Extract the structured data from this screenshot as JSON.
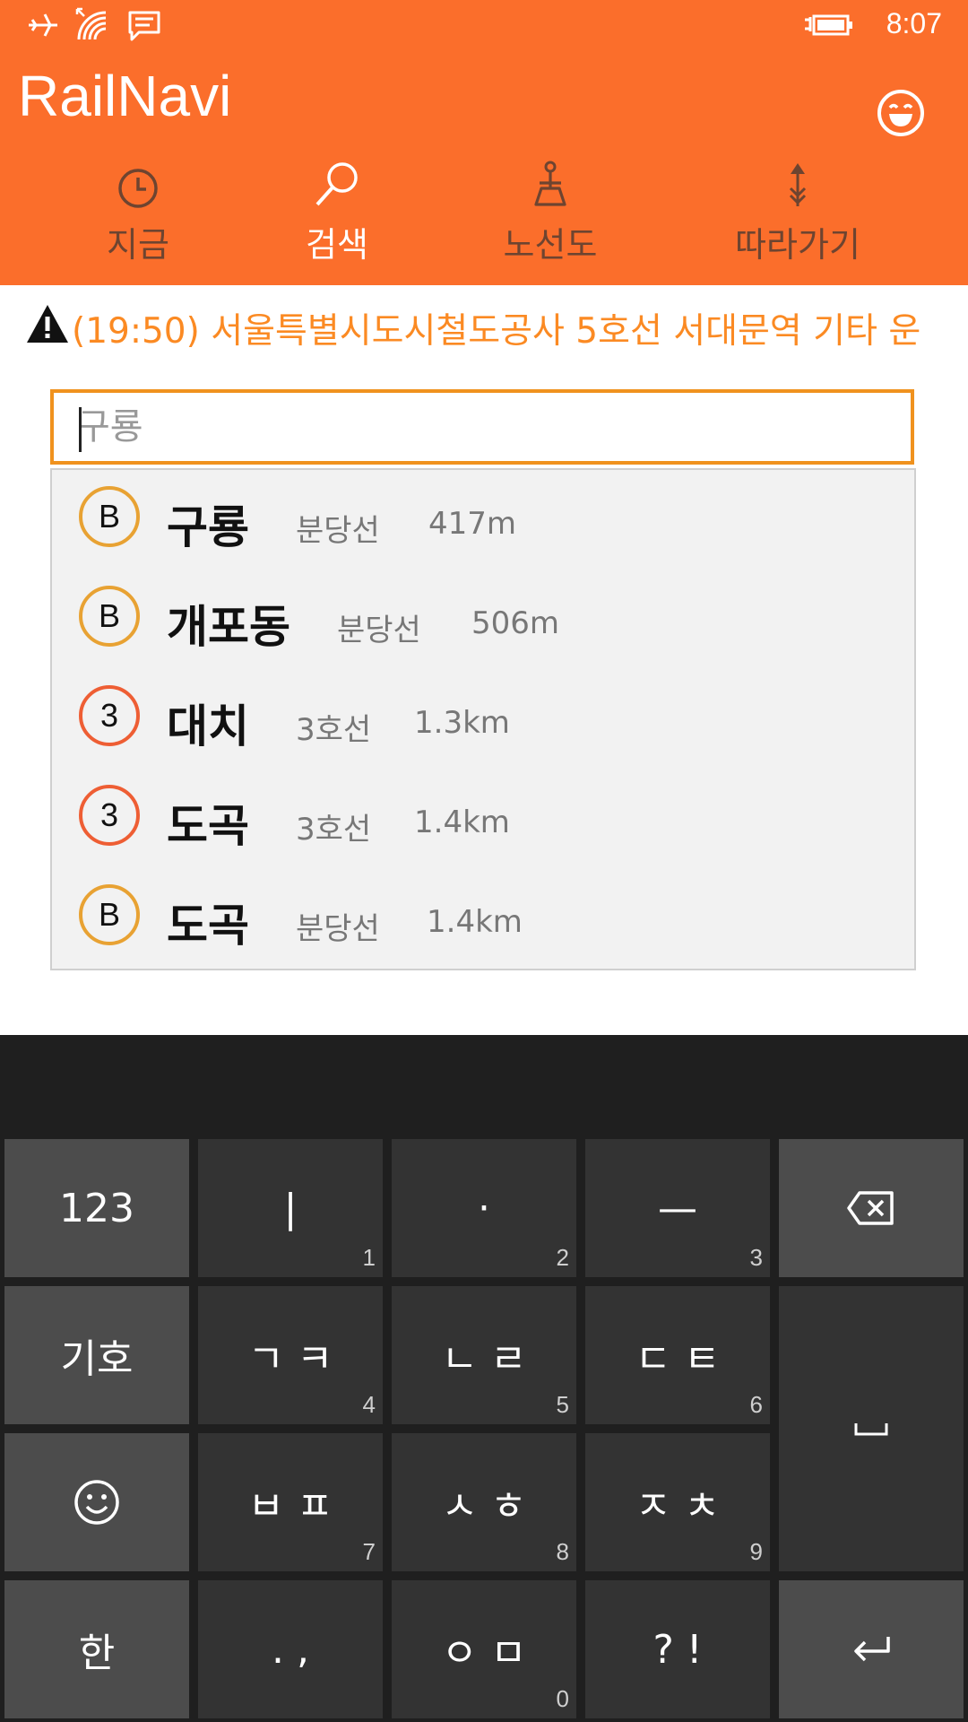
{
  "status_bar": {
    "time": "8:07",
    "icons": [
      "airplane-mode-icon",
      "wifi-icon",
      "message-icon",
      "battery-charging-icon"
    ]
  },
  "app": {
    "title": "RailNavi",
    "accent_color": "#fb6e2b"
  },
  "tabs": [
    {
      "label": "지금",
      "icon": "clock-icon"
    },
    {
      "label": "검색",
      "icon": "search-icon"
    },
    {
      "label": "노선도",
      "icon": "map-icon"
    },
    {
      "label": "따라가기",
      "icon": "follow-arrow-icon"
    }
  ],
  "alert": {
    "text": "(19:50) 서울특별시도시철도공사 5호선 서대문역 기타 운",
    "icon": "warning-icon",
    "color": "#fb8a23"
  },
  "search": {
    "value": "",
    "placeholder": "구룡"
  },
  "suggestions": [
    {
      "badge": "B",
      "name": "구룡",
      "line": "분당선",
      "distance": "417m"
    },
    {
      "badge": "B",
      "name": "개포동",
      "line": "분당선",
      "distance": "506m"
    },
    {
      "badge": "3",
      "name": "대치",
      "line": "3호선",
      "distance": "1.3km"
    },
    {
      "badge": "3",
      "name": "도곡",
      "line": "3호선",
      "distance": "1.4km"
    },
    {
      "badge": "B",
      "name": "도곡",
      "line": "분당선",
      "distance": "1.4km"
    }
  ],
  "line_colors": {
    "B": "#e8a233",
    "3": "#ee5e34"
  },
  "keyboard": {
    "rows": [
      [
        {
          "label": "123",
          "num": ""
        },
        {
          "label": "|",
          "num": "1"
        },
        {
          "label": "·",
          "num": "2"
        },
        {
          "label": "—",
          "num": "3"
        },
        {
          "label": "",
          "num": "",
          "icon": "backspace-icon"
        }
      ],
      [
        {
          "label": "기호",
          "num": ""
        },
        {
          "label": "ㄱ ㅋ",
          "num": "4"
        },
        {
          "label": "ㄴ ㄹ",
          "num": "5"
        },
        {
          "label": "ㄷ ㅌ",
          "num": "6"
        },
        {
          "label": "",
          "num": "",
          "icon": "space-icon"
        }
      ],
      [
        {
          "label": "",
          "num": "",
          "icon": "emoji-icon"
        },
        {
          "label": "ㅂ ㅍ",
          "num": "7"
        },
        {
          "label": "ㅅ ㅎ",
          "num": "8"
        },
        {
          "label": "ㅈ ㅊ",
          "num": "9"
        }
      ],
      [
        {
          "label": "한",
          "num": ""
        },
        {
          "label": ". ,",
          "num": ""
        },
        {
          "label": "ㅇ ㅁ",
          "num": "0"
        },
        {
          "label": "? !",
          "num": ""
        },
        {
          "label": "",
          "num": "",
          "icon": "enter-icon"
        }
      ]
    ]
  }
}
